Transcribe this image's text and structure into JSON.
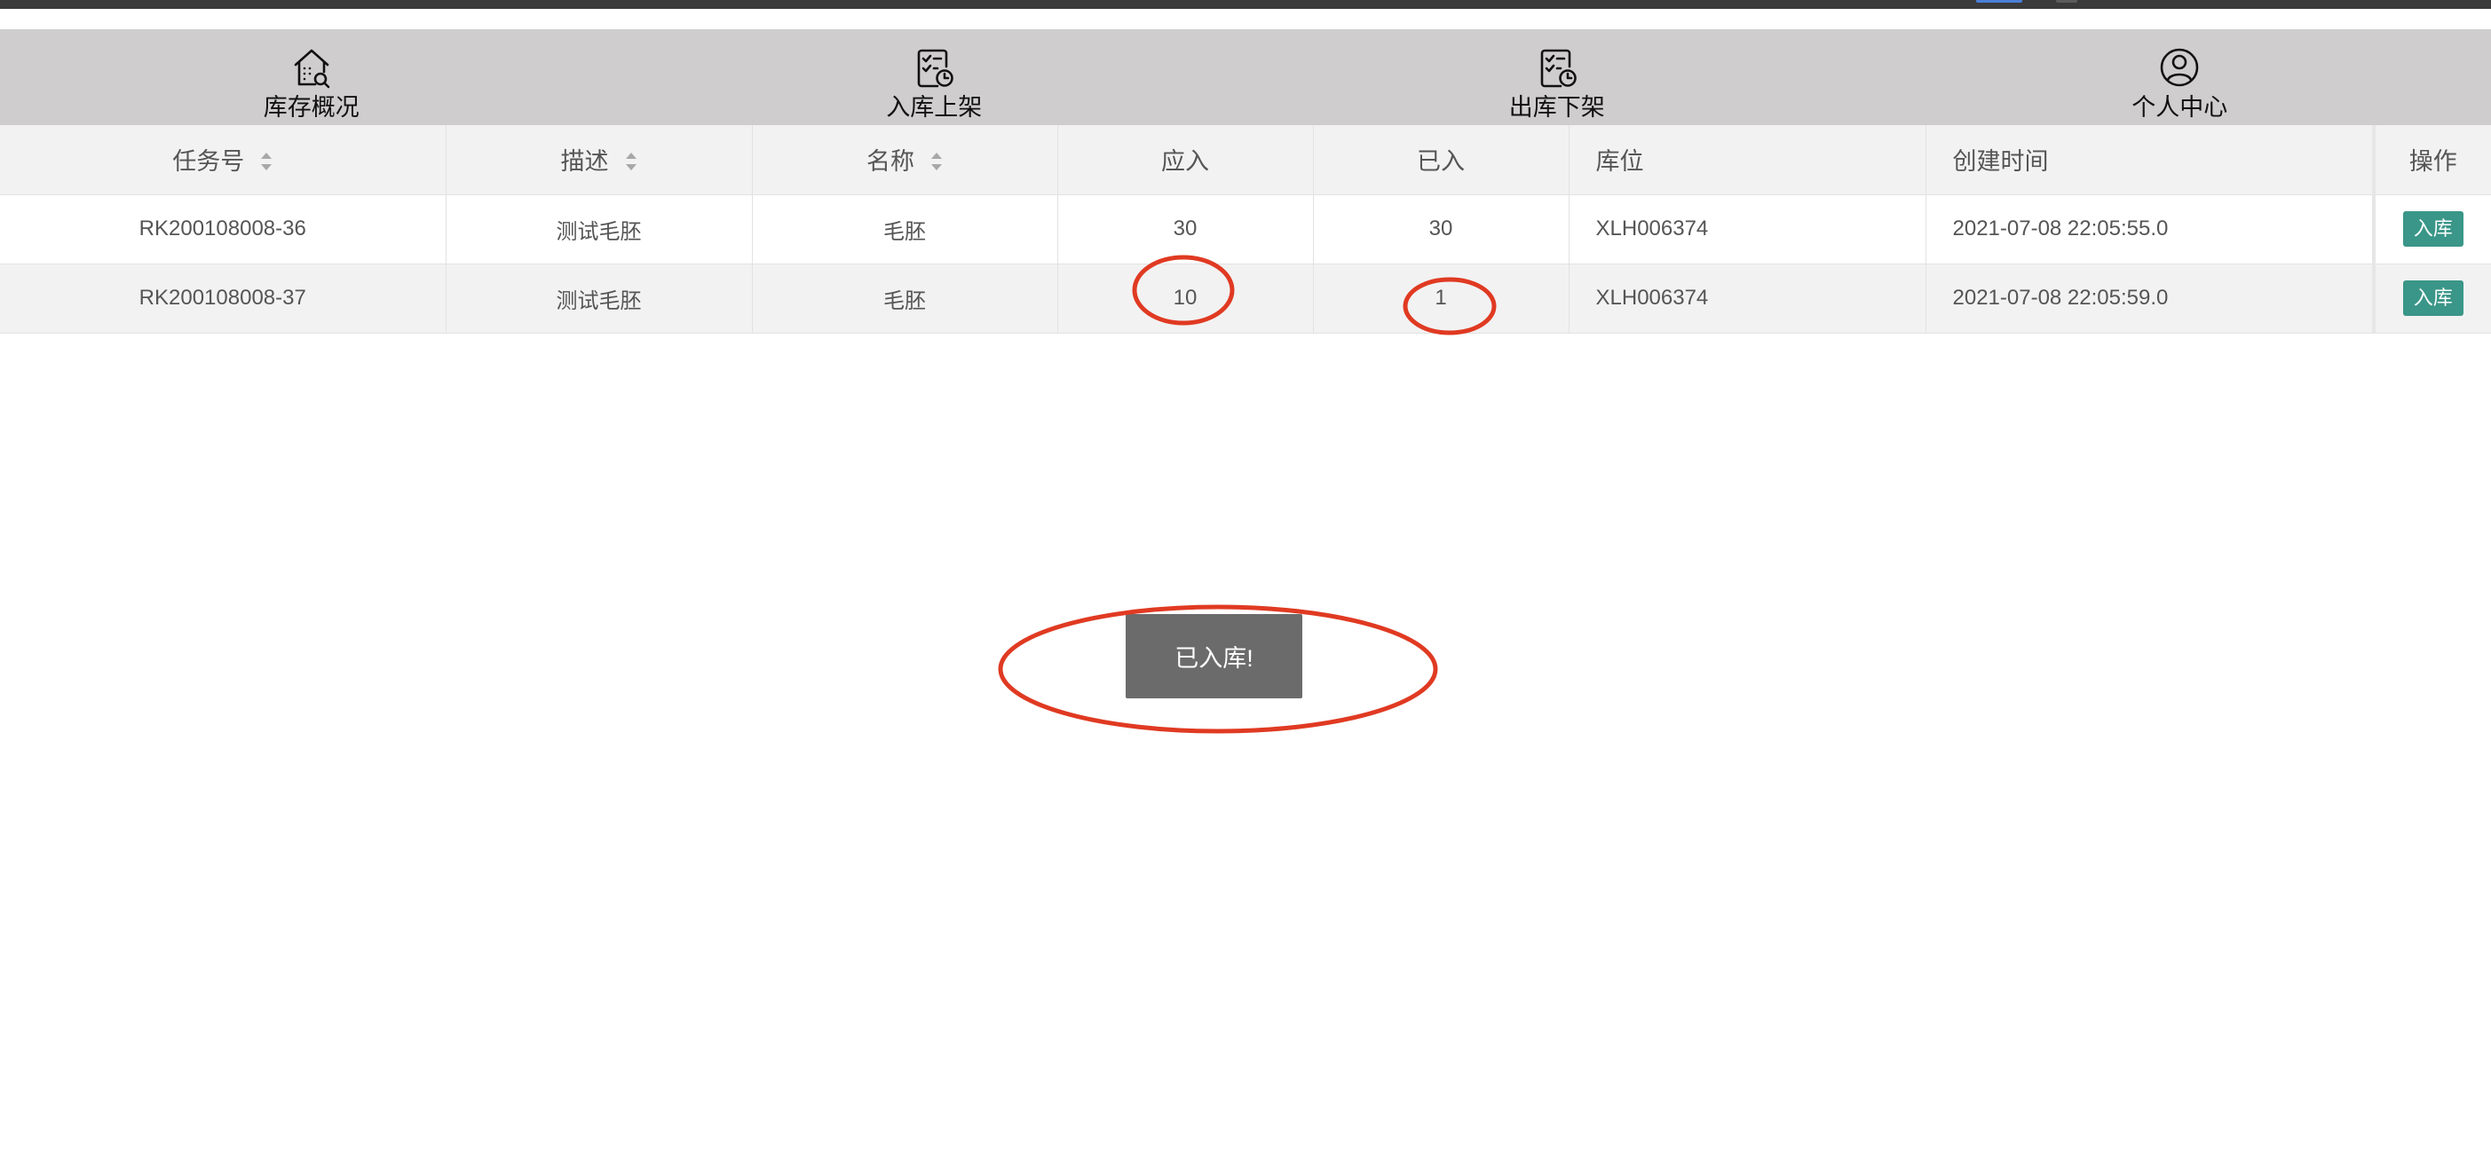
{
  "tabs": [
    {
      "label": "库存概况",
      "icon": "warehouse-search-icon"
    },
    {
      "label": "入库上架",
      "icon": "clipboard-clock-icon"
    },
    {
      "label": "出库下架",
      "icon": "clipboard-clock-icon"
    },
    {
      "label": "个人中心",
      "icon": "user-circle-icon"
    }
  ],
  "table": {
    "columns": [
      {
        "label": "任务号",
        "sortable": true
      },
      {
        "label": "描述",
        "sortable": true
      },
      {
        "label": "名称",
        "sortable": true
      },
      {
        "label": "应入",
        "sortable": false
      },
      {
        "label": "已入",
        "sortable": false
      },
      {
        "label": "库位",
        "sortable": false
      },
      {
        "label": "创建时间",
        "sortable": false
      },
      {
        "label": "操作",
        "sortable": false
      }
    ],
    "rows": [
      {
        "task_no": "RK200108008-36",
        "desc": "测试毛胚",
        "name": "毛胚",
        "expected": "30",
        "received": "30",
        "location": "XLH006374",
        "created": "2021-07-08 22:05:55.0",
        "action": "入库"
      },
      {
        "task_no": "RK200108008-37",
        "desc": "测试毛胚",
        "name": "毛胚",
        "expected": "10",
        "received": "1",
        "location": "XLH006374",
        "created": "2021-07-08 22:05:59.0",
        "action": "入库"
      }
    ]
  },
  "toast": {
    "text": "已入库!"
  },
  "colors": {
    "tabbar_bg": "#cfcdce",
    "header_bg": "#f2f2f2",
    "button_bg": "#3a9688",
    "toast_bg": "#6b6b6b",
    "annotation": "#e03a22"
  }
}
